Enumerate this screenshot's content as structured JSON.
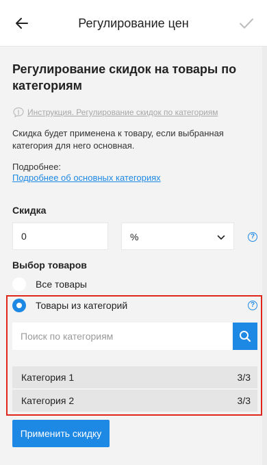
{
  "header": {
    "title": "Регулирование цен",
    "back_icon": "arrow-left-icon",
    "confirm_icon": "checkmark-icon"
  },
  "section": {
    "title": "Регулирование скидок на товары по категориям",
    "instruction_link": "Инструкция. Регулирование скидок по категориям",
    "description": "Скидка будет применена к товару, если выбранная категория для него основная.",
    "more_label": "Подробнее:",
    "more_link": "Подробнее об основных категориях"
  },
  "discount": {
    "label": "Скидка",
    "value": "0",
    "unit": "%"
  },
  "goods": {
    "label": "Выбор товаров",
    "options": [
      {
        "label": "Все товары",
        "checked": false
      },
      {
        "label": "Товары из категорий",
        "checked": true
      }
    ]
  },
  "search": {
    "placeholder": "Поиск по категориям"
  },
  "categories": [
    {
      "name": "Категория 1",
      "count": "3/3"
    },
    {
      "name": "Категория 2",
      "count": "3/3"
    }
  ],
  "apply_button": "Применить скидку",
  "colors": {
    "accent": "#1e88e5",
    "highlight": "#e0251b",
    "background": "#f3f3f3"
  }
}
